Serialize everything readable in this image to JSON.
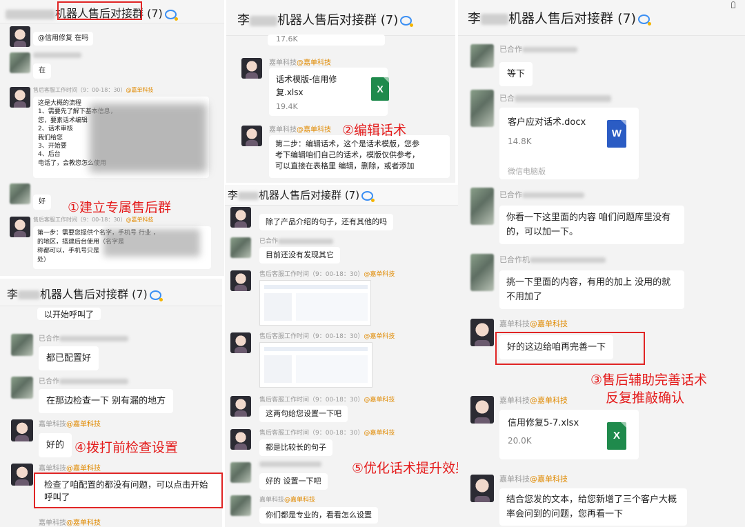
{
  "panels": {
    "p1": {
      "title_suffix": "机器人售后对接群",
      "count": "(7)"
    },
    "p2": {
      "title_prefix": "李",
      "title_suffix": "机器人售后对接群",
      "count": "(7)"
    },
    "p3": {
      "title_prefix": "李",
      "title_suffix": "机器人售后对接群",
      "count": "(7)"
    },
    "p4": {
      "title_prefix": "李",
      "title_suffix": "机器人售后对接群",
      "count": "(7)"
    },
    "p5": {
      "title_prefix": "李",
      "title_suffix": "机器人售后对接群",
      "count": "(7)"
    }
  },
  "p1": {
    "m1": "@信用修复  在吗",
    "m2": "在",
    "m3_sender": "售后客服工作时间（9：00-18：30）",
    "tag": "@嘉单科技",
    "m3_lines": [
      "这是大概的流程",
      "1、需要先了解下基本信息，",
      "您，要素话术编辑",
      "2、话术审核",
      "我们给您",
      "3、开始要",
      "4、后台",
      "电话了，会教您怎么使用"
    ],
    "m4": "好",
    "m5_sender": "售后客服工作时间（9：00-18：30）",
    "m5_lines": [
      "第一步：需要您提供个名字，手机号    行业  ，",
      "的地区，搭建后台使用（名字是",
      "称都可以，手机号只是",
      "处）"
    ]
  },
  "p2": {
    "file_size_top": "17.6K",
    "sender1": "嘉单科技",
    "tag": "@嘉单科技",
    "file_name_line1": "话术模版-信用修",
    "file_name_line2": "复.xlsx",
    "file_size": "19.4K",
    "sender2": "嘉单科技",
    "msg_lines": [
      "第二步：编辑话术，这个是话术模版，您参",
      "考下编辑咱们自己的话术，模版仅供参考，",
      "可以直接在表格里 编辑，删除，或者添加"
    ]
  },
  "p3": {
    "m1": "除了产品介绍的句子，还有其他的吗",
    "m2_sender": "已合作",
    "m2": "目前还没有发现其它",
    "m3_sender": "售后客服工作时间（9：00-18：30）",
    "tag": "@嘉单科技",
    "m5": "这两句给您设置一下吧",
    "m6": "都是比较长的句子",
    "m7": "好的  设置一下吧",
    "m8_sender": "嘉单科技",
    "m8": "你们都是专业的，看看怎么设置"
  },
  "p4": {
    "m0": "以开始呼叫了",
    "m1_sender": "已合作",
    "m1": "都已配置好",
    "m2_sender": "已合作",
    "m2": "在那边检查一下  别有漏的地方",
    "m3_sender": "嘉单科技",
    "tag": "@嘉单科技",
    "m3": "好的",
    "m4_sender": "嘉单科技",
    "m4_lines": [
      "检查了咱配置的都没有问题，可以点击开始",
      "呼叫了"
    ],
    "m5_sender": "嘉单科技"
  },
  "p5": {
    "m1_sender": "已合作",
    "m1": "等下",
    "m2_sender": "已合",
    "file_name": "客户应对话术.docx",
    "file_size": "14.8K",
    "file_source": "微信电脑版",
    "m3_sender": "已合作",
    "m3_lines": [
      "你看一下这里面的内容   咱们问题库里没有",
      "的，可以加一下。"
    ],
    "m4_sender": "已合作机",
    "m4_lines": [
      "挑一下里面的内容，有用的加上   没用的就",
      "不用加了"
    ],
    "m5_sender": "嘉单科技",
    "tag": "@嘉单科技",
    "m5": "好的这边给咱再完善一下",
    "m6_sender": "嘉单科技",
    "file2_name": "信用修复5-7.xlsx",
    "file2_size": "20.0K",
    "m7_sender": "嘉单科技",
    "m7_lines": [
      "结合您发的文本，给您新增了三个客户大概",
      "率会问到的问题，您再看一下"
    ]
  },
  "icons": {
    "excel": "X",
    "word": "W"
  },
  "annotations": {
    "a1": "①建立专属售后群",
    "a2": "②编辑话术",
    "a3_line1": "③售后辅助完善话术",
    "a3_line2": "反复推敲确认",
    "a4": "④拨打前检查设置",
    "a5": "⑤优化话术提升效果"
  },
  "colors": {
    "annotation": "#e41b1b",
    "tag": "#e08a00",
    "excel": "#1f8a4c",
    "word": "#2b5cc4"
  }
}
